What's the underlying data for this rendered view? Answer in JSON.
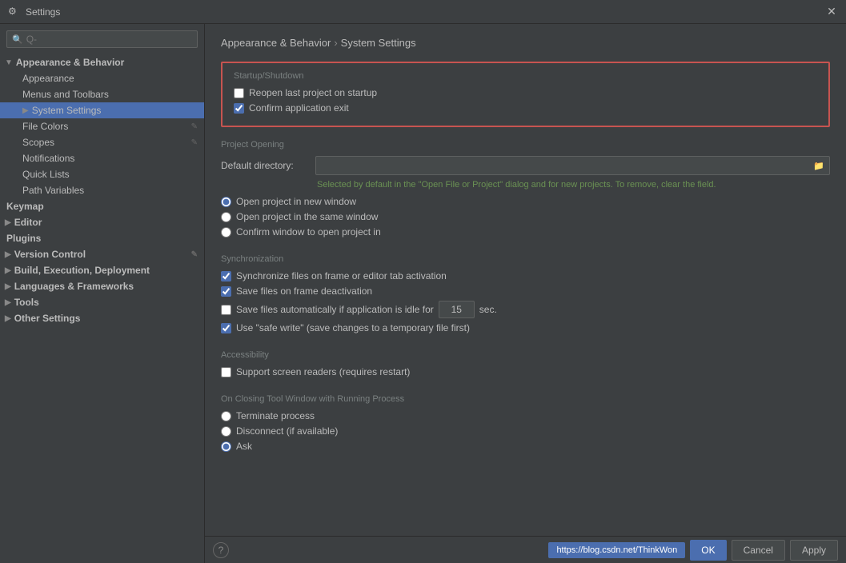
{
  "window": {
    "title": "Settings",
    "icon": "⚙"
  },
  "breadcrumb": {
    "parent": "Appearance & Behavior",
    "separator": "›",
    "current": "System Settings"
  },
  "sidebar": {
    "search_placeholder": "Q-",
    "items": [
      {
        "id": "appearance-behavior",
        "label": "Appearance & Behavior",
        "type": "parent",
        "expanded": true
      },
      {
        "id": "appearance",
        "label": "Appearance",
        "type": "child"
      },
      {
        "id": "menus-toolbars",
        "label": "Menus and Toolbars",
        "type": "child"
      },
      {
        "id": "system-settings",
        "label": "System Settings",
        "type": "child",
        "selected": true,
        "has_arrow": true
      },
      {
        "id": "file-colors",
        "label": "File Colors",
        "type": "child",
        "has_edit": true
      },
      {
        "id": "scopes",
        "label": "Scopes",
        "type": "child",
        "has_edit": true
      },
      {
        "id": "notifications",
        "label": "Notifications",
        "type": "child"
      },
      {
        "id": "quick-lists",
        "label": "Quick Lists",
        "type": "child"
      },
      {
        "id": "path-variables",
        "label": "Path Variables",
        "type": "child"
      },
      {
        "id": "keymap",
        "label": "Keymap",
        "type": "parent2"
      },
      {
        "id": "editor",
        "label": "Editor",
        "type": "parent-collapsed"
      },
      {
        "id": "plugins",
        "label": "Plugins",
        "type": "parent2"
      },
      {
        "id": "version-control",
        "label": "Version Control",
        "type": "parent-collapsed",
        "has_edit": true
      },
      {
        "id": "build-execution",
        "label": "Build, Execution, Deployment",
        "type": "parent-collapsed"
      },
      {
        "id": "languages-frameworks",
        "label": "Languages & Frameworks",
        "type": "parent-collapsed"
      },
      {
        "id": "tools",
        "label": "Tools",
        "type": "parent-collapsed"
      },
      {
        "id": "other-settings",
        "label": "Other Settings",
        "type": "parent-collapsed"
      }
    ]
  },
  "startup_shutdown": {
    "title": "Startup/Shutdown",
    "reopen_last_project": {
      "label": "Reopen last project on startup",
      "checked": false
    },
    "confirm_exit": {
      "label": "Confirm application exit",
      "checked": true
    }
  },
  "project_opening": {
    "title": "Project Opening",
    "default_directory_label": "Default directory:",
    "default_directory_value": "",
    "default_directory_placeholder": "",
    "hint": "Selected by default in the \"Open File or Project\" dialog and for new projects. To remove, clear the field.",
    "options": [
      {
        "id": "new-window",
        "label": "Open project in new window",
        "selected": true
      },
      {
        "id": "same-window",
        "label": "Open project in the same window",
        "selected": false
      },
      {
        "id": "confirm-window",
        "label": "Confirm window to open project in",
        "selected": false
      }
    ]
  },
  "synchronization": {
    "title": "Synchronization",
    "sync_files": {
      "label": "Synchronize files on frame or editor tab activation",
      "checked": true
    },
    "save_files_deactivation": {
      "label": "Save files on frame deactivation",
      "checked": true
    },
    "save_files_idle": {
      "label": "Save files automatically if application is idle for",
      "checked": false,
      "value": "15",
      "unit": "sec."
    },
    "safe_write": {
      "label": "Use \"safe write\" (save changes to a temporary file first)",
      "checked": true
    }
  },
  "accessibility": {
    "title": "Accessibility",
    "screen_readers": {
      "label": "Support screen readers (requires restart)",
      "checked": false
    }
  },
  "closing": {
    "title": "On Closing Tool Window with Running Process",
    "options": [
      {
        "id": "terminate",
        "label": "Terminate process",
        "selected": false
      },
      {
        "id": "disconnect",
        "label": "Disconnect (if available)",
        "selected": false
      },
      {
        "id": "ask",
        "label": "Ask",
        "selected": true
      }
    ]
  },
  "bottom_bar": {
    "help_label": "?",
    "ok_label": "OK",
    "cancel_label": "Cancel",
    "apply_label": "Apply",
    "url": "https://blog.csdn.net/ThinkWon"
  }
}
